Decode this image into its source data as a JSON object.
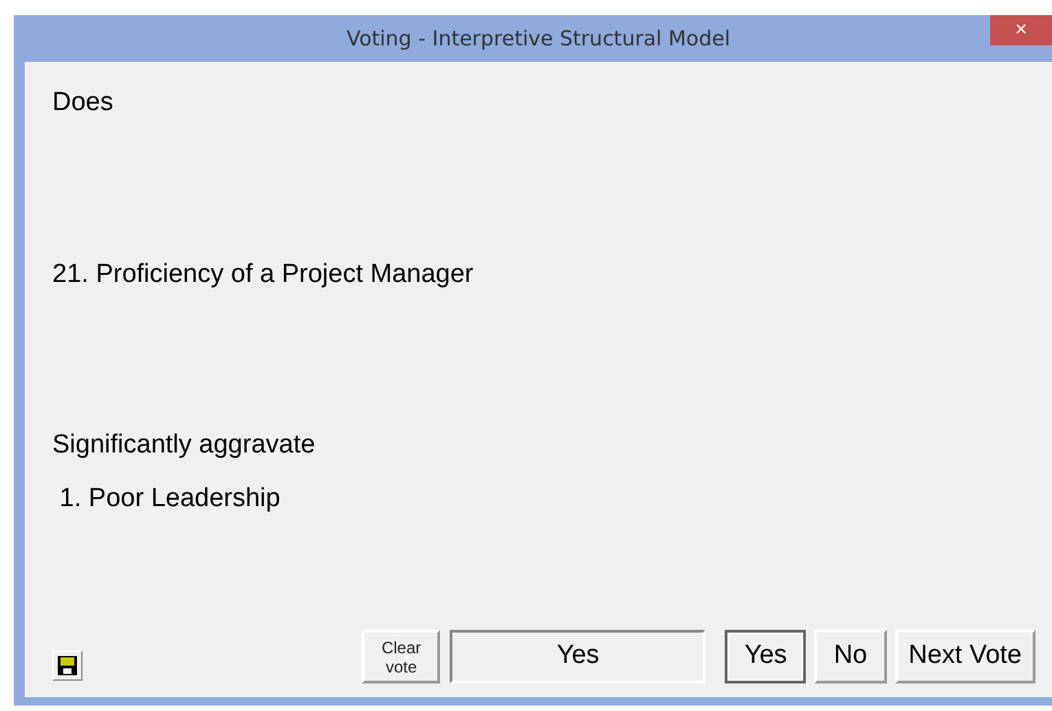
{
  "window": {
    "title": "Voting - Interpretive Structural Model",
    "close": "×"
  },
  "question": {
    "lead": "Does",
    "subject": "21. Proficiency of a Project Manager",
    "relation": "Significantly aggravate",
    "object": " 1. Poor Leadership"
  },
  "clear_button": {
    "label": "Clear\nvote"
  },
  "current_vote": {
    "value": "Yes"
  },
  "vote_buttons": [
    {
      "label": "Yes",
      "selected": true
    },
    {
      "label": "No",
      "selected": false
    }
  ],
  "next_button": {
    "label": "Next Vote"
  }
}
